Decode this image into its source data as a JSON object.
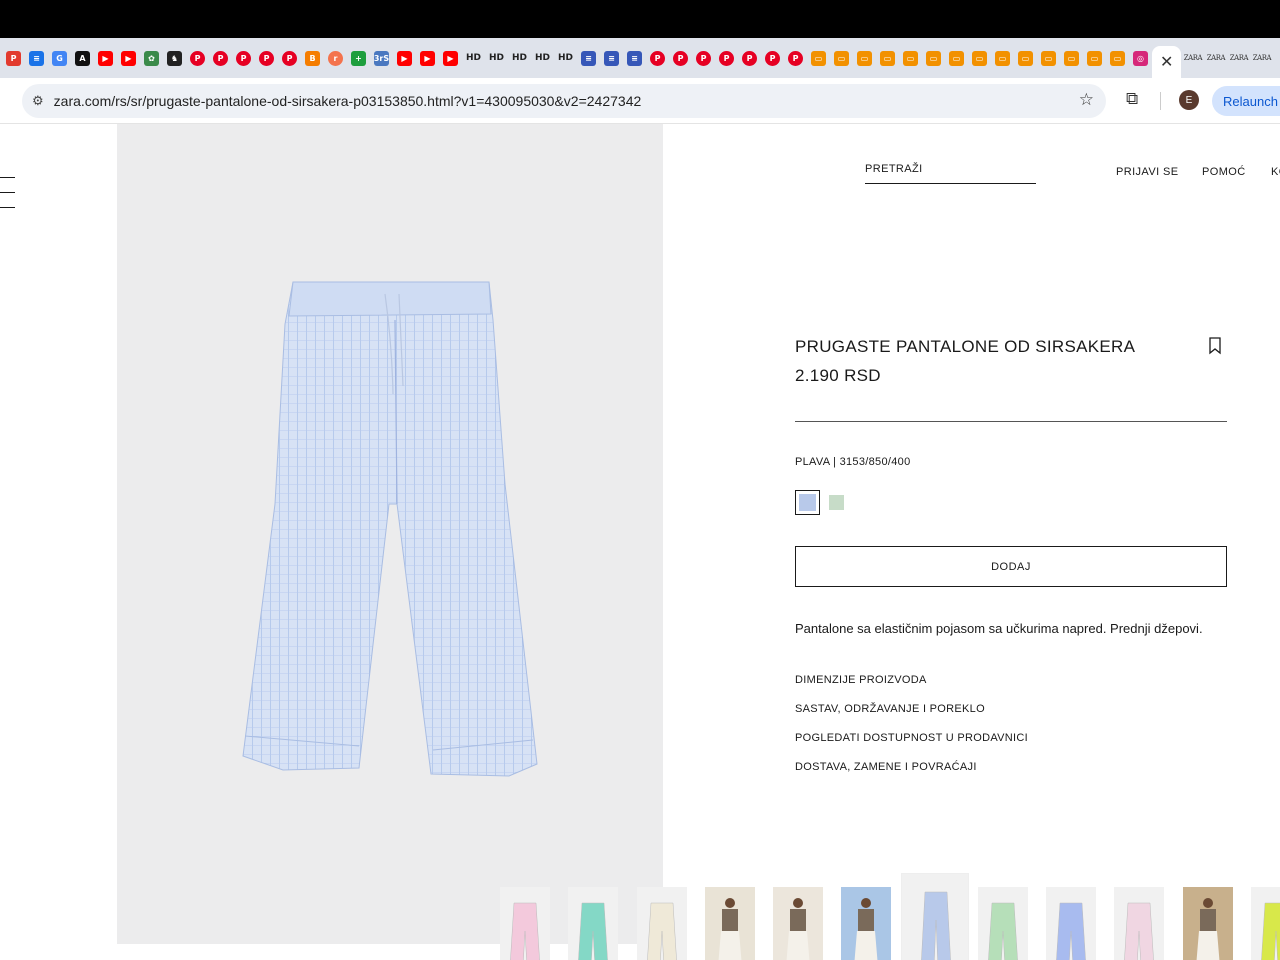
{
  "browser": {
    "tabs": {
      "favicons": [
        {
          "icon": "pdf-icon",
          "color": "#e23a2e",
          "text": "P"
        },
        {
          "icon": "chat-icon",
          "color": "#1a73e8",
          "text": "≡"
        },
        {
          "icon": "translate-icon",
          "color": "#4285f4",
          "text": "G"
        },
        {
          "icon": "a-icon",
          "color": "#111111",
          "text": "A"
        },
        {
          "icon": "youtube-icon",
          "color": "#ff0000",
          "text": "▶"
        },
        {
          "icon": "youtube-icon",
          "color": "#ff0000",
          "text": "▶"
        },
        {
          "icon": "flower-icon",
          "color": "#3a8a4a",
          "text": "✿"
        },
        {
          "icon": "knight-icon",
          "color": "#222222",
          "text": "♞"
        },
        {
          "icon": "pinterest-icon",
          "color": "#e60023",
          "text": "P"
        },
        {
          "icon": "pinterest-icon",
          "color": "#e60023",
          "text": "P"
        },
        {
          "icon": "pinterest-icon",
          "color": "#e60023",
          "text": "P"
        },
        {
          "icon": "pinterest-icon",
          "color": "#e60023",
          "text": "P"
        },
        {
          "icon": "pinterest-icon",
          "color": "#e60023",
          "text": "P"
        },
        {
          "icon": "blogger-icon",
          "color": "#f57d00",
          "text": "B"
        },
        {
          "icon": "orange-circle-icon",
          "color": "#f4734d",
          "text": "r"
        },
        {
          "icon": "plus-square-icon",
          "color": "#1e9e3e",
          "text": "+"
        },
        {
          "icon": "mini-text-icon",
          "color": "#4a78c0",
          "text": "3rS"
        },
        {
          "icon": "youtube-icon",
          "color": "#ff0000",
          "text": "▶"
        },
        {
          "icon": "youtube-icon",
          "color": "#ff0000",
          "text": "▶"
        },
        {
          "icon": "youtube-icon",
          "color": "#ff0000",
          "text": "▶"
        },
        {
          "icon": "hd-icon",
          "color": "transparent",
          "text": "HD"
        },
        {
          "icon": "hd-icon",
          "color": "transparent",
          "text": "HD"
        },
        {
          "icon": "hd-icon",
          "color": "transparent",
          "text": "HD"
        },
        {
          "icon": "hd-icon",
          "color": "transparent",
          "text": "HD"
        },
        {
          "icon": "hd-icon",
          "color": "transparent",
          "text": "HD"
        },
        {
          "icon": "flag-icon",
          "color": "#3657b8",
          "text": "≡"
        },
        {
          "icon": "flag-icon",
          "color": "#3657b8",
          "text": "≡"
        },
        {
          "icon": "flag-icon",
          "color": "#3657b8",
          "text": "≡"
        },
        {
          "icon": "pinterest-icon",
          "color": "#e60023",
          "text": "P"
        },
        {
          "icon": "pinterest-icon",
          "color": "#e60023",
          "text": "P"
        },
        {
          "icon": "pinterest-icon",
          "color": "#e60023",
          "text": "P"
        },
        {
          "icon": "pinterest-icon",
          "color": "#e60023",
          "text": "P"
        },
        {
          "icon": "pinterest-icon",
          "color": "#e60023",
          "text": "P"
        },
        {
          "icon": "pinterest-icon",
          "color": "#e60023",
          "text": "P"
        },
        {
          "icon": "pinterest-icon",
          "color": "#e60023",
          "text": "P"
        },
        {
          "icon": "orange-app-icon",
          "color": "#f29100",
          "text": "▭"
        },
        {
          "icon": "orange-app-icon",
          "color": "#f29100",
          "text": "▭"
        },
        {
          "icon": "orange-app-icon",
          "color": "#f29100",
          "text": "▭"
        },
        {
          "icon": "orange-app-icon",
          "color": "#f29100",
          "text": "▭"
        },
        {
          "icon": "orange-app-icon",
          "color": "#f29100",
          "text": "▭"
        },
        {
          "icon": "orange-app-icon",
          "color": "#f29100",
          "text": "▭"
        },
        {
          "icon": "orange-app-icon",
          "color": "#f29100",
          "text": "▭"
        },
        {
          "icon": "orange-app-icon",
          "color": "#f29100",
          "text": "▭"
        },
        {
          "icon": "orange-app-icon",
          "color": "#f29100",
          "text": "▭"
        },
        {
          "icon": "orange-app-icon",
          "color": "#f29100",
          "text": "▭"
        },
        {
          "icon": "orange-app-icon",
          "color": "#f29100",
          "text": "▭"
        },
        {
          "icon": "orange-app-icon",
          "color": "#f29100",
          "text": "▭"
        },
        {
          "icon": "orange-app-icon",
          "color": "#f29100",
          "text": "▭"
        },
        {
          "icon": "orange-app-icon",
          "color": "#f29100",
          "text": "▭"
        },
        {
          "icon": "instagram-icon",
          "color": "#d6287a",
          "text": "◎"
        }
      ],
      "active_close": "✕",
      "zara_tabs": [
        "ZARA",
        "ZARA",
        "ZARA",
        "ZARA"
      ],
      "new_tab": "+"
    },
    "address": {
      "url": "zara.com/rs/sr/prugaste-pantalone-od-sirsakera-p03153850.html?v1=430095030&v2=2427342",
      "avatar_letter": "E",
      "relaunch_label": "Relaunch"
    }
  },
  "header": {
    "search_label": "PRETRAŽI",
    "nav": [
      "PRIJAVI SE",
      "POMOĆ",
      "KORPA"
    ]
  },
  "product": {
    "title": "PRUGASTE PANTALONE OD SIRSAKERA",
    "price": "2.190 RSD",
    "color_info": "PLAVA | 3153/850/400",
    "colors": [
      "#b8c9ea",
      "#c7dcc8"
    ],
    "add_label": "DODAJ",
    "description": "Pantalone sa elastičnim pojasom sa učkurima napred. Prednji džepovi.",
    "info_links": [
      "DIMENZIJE PROIZVODA",
      "SASTAV, ODRŽAVANJE I POREKLO",
      "POGLEDATI DOSTUPNOST U PRODAVNICI",
      "DOSTAVA, ZAMENE I POVRAĆAJI"
    ]
  },
  "thumbnails": [
    {
      "color": "#f3c9dc",
      "kind": "pants"
    },
    {
      "color": "#84d8c6",
      "kind": "pants"
    },
    {
      "color": "#efe9d8",
      "kind": "pants"
    },
    {
      "color": "#e9e3d6",
      "kind": "model"
    },
    {
      "color": "#ece6dc",
      "kind": "model"
    },
    {
      "color": "#aac6e6",
      "kind": "model"
    },
    {
      "color": "#b8c9ea",
      "kind": "pants",
      "active": true
    },
    {
      "color": "#b6dfb9",
      "kind": "pants"
    },
    {
      "color": "#a8bbef",
      "kind": "pants"
    },
    {
      "color": "#f0d6e2",
      "kind": "pants"
    },
    {
      "color": "#c8b08c",
      "kind": "model"
    },
    {
      "color": "#d8e84a",
      "kind": "pants"
    }
  ]
}
